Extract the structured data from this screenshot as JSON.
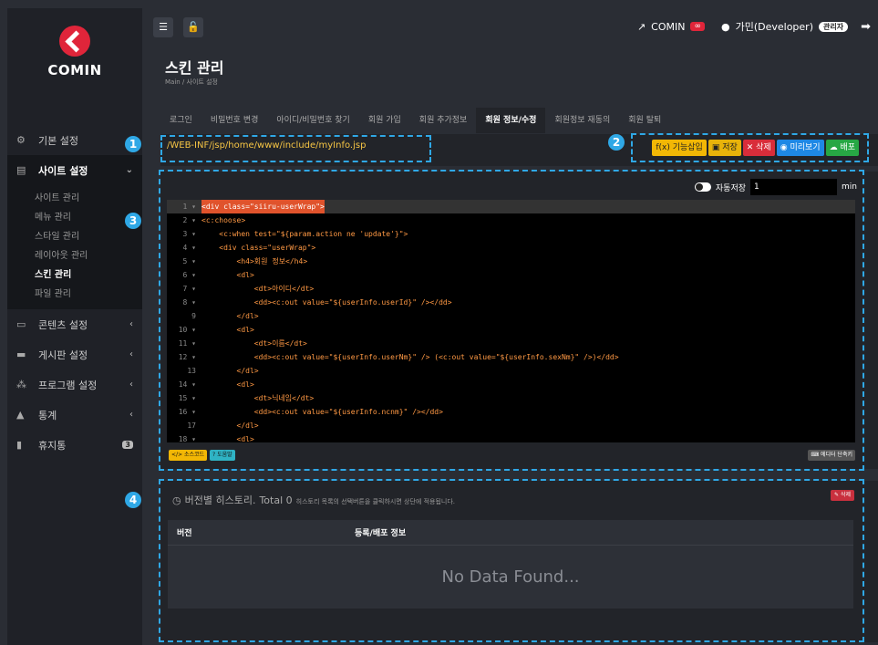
{
  "app": {
    "logo": "COMIN"
  },
  "sidebar": {
    "items": [
      {
        "label": "기본 설정",
        "icon": "gear-icon"
      },
      {
        "label": "사이트 설정",
        "icon": "site-icon"
      },
      {
        "label": "콘텐츠 설정",
        "icon": "content-icon"
      },
      {
        "label": "게시판 설정",
        "icon": "board-icon"
      },
      {
        "label": "프로그램 설정",
        "icon": "program-icon"
      },
      {
        "label": "통계",
        "icon": "chart-icon"
      },
      {
        "label": "휴지통",
        "icon": "trash-icon",
        "badge": "3"
      }
    ],
    "sub": [
      "사이트 관리",
      "메뉴 관리",
      "스타일 관리",
      "레이아웃 관리",
      "스킨 관리",
      "파일 관리"
    ]
  },
  "topbar": {
    "site": "COMIN",
    "user": "가민(Developer)",
    "role": "관리자"
  },
  "page": {
    "title": "스킨 관리",
    "breadcrumb": "Main / 사이트 설정"
  },
  "tabs": [
    "로그인",
    "비밀번호 변경",
    "아이디/비밀번호 찾기",
    "회원 가입",
    "회원 추가정보",
    "회원 정보/수정",
    "회원정보 재동의",
    "회원 탈퇴"
  ],
  "path": "/WEB-INF/jsp/home/www/include/myInfo.jsp",
  "actions": {
    "func": "f(x) 기능삽입",
    "save": "저장",
    "delete": "삭제",
    "preview": "미리보기",
    "deploy": "배포"
  },
  "autosave": {
    "label": "자동저장",
    "value": "1",
    "unit": "min"
  },
  "code": [
    {
      "n": "1 ▾",
      "t": "<div class=\"siiru-userWrap\">"
    },
    {
      "n": "2 ▾",
      "t": "<c:choose>"
    },
    {
      "n": "3 ▾",
      "t": "    <c:when test=\"${param.action ne 'update'}\">"
    },
    {
      "n": "4 ▾",
      "t": "    <div class=\"userWrap\">"
    },
    {
      "n": "5 ▾",
      "t": "        <h4>회원 정보</h4>"
    },
    {
      "n": "6 ▾",
      "t": "        <dl>"
    },
    {
      "n": "7 ▾",
      "t": "            <dt>아이디</dt>"
    },
    {
      "n": "8 ▾",
      "t": "            <dd><c:out value=\"${userInfo.userId}\" /></dd>"
    },
    {
      "n": "9",
      "t": "        </dl>"
    },
    {
      "n": "10 ▾",
      "t": "        <dl>"
    },
    {
      "n": "11 ▾",
      "t": "            <dt>이름</dt>"
    },
    {
      "n": "12 ▾",
      "t": "            <dd><c:out value=\"${userInfo.userNm}\" /> (<c:out value=\"${userInfo.sexNm}\" />)</dd>"
    },
    {
      "n": "13",
      "t": "        </dl>"
    },
    {
      "n": "14 ▾",
      "t": "        <dl>"
    },
    {
      "n": "15 ▾",
      "t": "            <dt>닉네임</dt>"
    },
    {
      "n": "16 ▾",
      "t": "            <dd><c:out value=\"${userInfo.ncnm}\" /></dd>"
    },
    {
      "n": "17",
      "t": "        </dl>"
    },
    {
      "n": "18 ▾",
      "t": "        <dl>"
    }
  ],
  "editor_footer": {
    "source": "</> 소스코드",
    "help": "도움말",
    "shortcut": "에디터 단축키"
  },
  "history": {
    "title": "버전별 히스토리.",
    "total": "Total 0",
    "desc": "히스토리 목록의 선택버튼을 클릭하시면 상단에 적용됩니다.",
    "delete": "삭제",
    "col_version": "버전",
    "col_info": "등록/배포 정보",
    "empty": "No Data Found..."
  },
  "markers": [
    "1",
    "2",
    "3",
    "4"
  ]
}
